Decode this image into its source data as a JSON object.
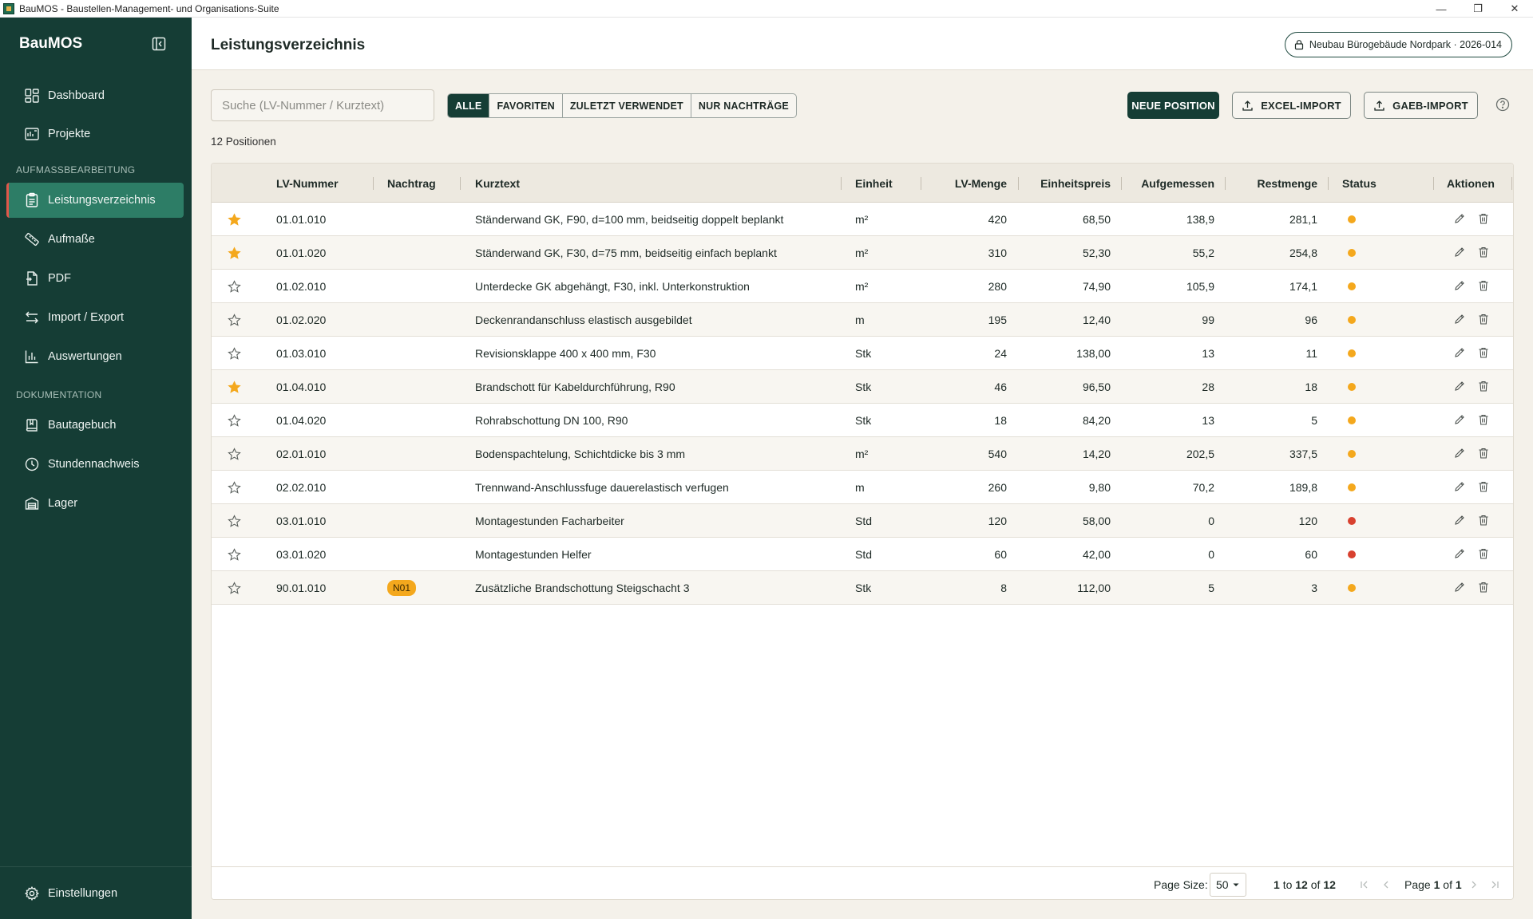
{
  "window": {
    "title": "BauMOS - Baustellen-Management- und Organisations-Suite",
    "controls": [
      "—",
      "❐",
      "✕"
    ]
  },
  "sidebar": {
    "brand": "BauMOS",
    "items_top": [
      {
        "label": "Dashboard",
        "icon": "dashboard-icon"
      },
      {
        "label": "Projekte",
        "icon": "projects-icon"
      }
    ],
    "section1": "AUFMASSBEARBEITUNG",
    "items_mid": [
      {
        "label": "Leistungsverzeichnis",
        "icon": "clipboard-icon",
        "active": true
      },
      {
        "label": "Aufmaße",
        "icon": "ruler-icon"
      },
      {
        "label": "PDF",
        "icon": "file-icon"
      },
      {
        "label": "Import / Export",
        "icon": "arrows-icon"
      },
      {
        "label": "Auswertungen",
        "icon": "chart-icon"
      }
    ],
    "section2": "DOKUMENTATION",
    "items_doc": [
      {
        "label": "Bautagebuch",
        "icon": "book-icon"
      },
      {
        "label": "Stundennachweis",
        "icon": "clock-icon"
      },
      {
        "label": "Lager",
        "icon": "warehouse-icon"
      }
    ],
    "settings": "Einstellungen"
  },
  "header": {
    "title": "Leistungsverzeichnis",
    "project": "Neubau Bürogebäude Nordpark · 2026-014"
  },
  "toolbar": {
    "search_placeholder": "Suche (LV-Nummer / Kurztext)",
    "filters": [
      "ALLE",
      "FAVORITEN",
      "ZULETZT VERWENDET",
      "NUR NACHTRÄGE"
    ],
    "active_filter": "ALLE",
    "new_button": "NEUE POSITION",
    "excel_button": "EXCEL-IMPORT",
    "gaeb_button": "GAEB-IMPORT"
  },
  "count_label": "12 Positionen",
  "table": {
    "headers": {
      "lv": "LV-Nummer",
      "nachtrag": "Nachtrag",
      "kurztext": "Kurztext",
      "einheit": "Einheit",
      "menge": "LV-Menge",
      "preis": "Einheitspreis",
      "aufgemessen": "Aufgemessen",
      "rest": "Restmenge",
      "status": "Status",
      "aktionen": "Aktionen"
    },
    "rows": [
      {
        "fav": true,
        "lv": "01.01.010",
        "nachtrag": "",
        "kurztext": "Ständerwand GK, F90, d=100 mm, beidseitig doppelt beplankt",
        "einheit": "m²",
        "menge": "420",
        "preis": "68,50",
        "aufgemessen": "138,9",
        "rest": "281,1",
        "status": "orange"
      },
      {
        "fav": true,
        "lv": "01.01.020",
        "nachtrag": "",
        "kurztext": "Ständerwand GK, F30, d=75 mm, beidseitig einfach beplankt",
        "einheit": "m²",
        "menge": "310",
        "preis": "52,30",
        "aufgemessen": "55,2",
        "rest": "254,8",
        "status": "orange"
      },
      {
        "fav": false,
        "lv": "01.02.010",
        "nachtrag": "",
        "kurztext": "Unterdecke GK abgehängt, F30, inkl. Unterkonstruktion",
        "einheit": "m²",
        "menge": "280",
        "preis": "74,90",
        "aufgemessen": "105,9",
        "rest": "174,1",
        "status": "orange"
      },
      {
        "fav": false,
        "lv": "01.02.020",
        "nachtrag": "",
        "kurztext": "Deckenrandanschluss elastisch ausgebildet",
        "einheit": "m",
        "menge": "195",
        "preis": "12,40",
        "aufgemessen": "99",
        "rest": "96",
        "status": "orange"
      },
      {
        "fav": false,
        "lv": "01.03.010",
        "nachtrag": "",
        "kurztext": "Revisionsklappe 400 x 400 mm, F30",
        "einheit": "Stk",
        "menge": "24",
        "preis": "138,00",
        "aufgemessen": "13",
        "rest": "11",
        "status": "orange"
      },
      {
        "fav": true,
        "lv": "01.04.010",
        "nachtrag": "",
        "kurztext": "Brandschott für Kabeldurchführung, R90",
        "einheit": "Stk",
        "menge": "46",
        "preis": "96,50",
        "aufgemessen": "28",
        "rest": "18",
        "status": "orange"
      },
      {
        "fav": false,
        "lv": "01.04.020",
        "nachtrag": "",
        "kurztext": "Rohrabschottung DN 100, R90",
        "einheit": "Stk",
        "menge": "18",
        "preis": "84,20",
        "aufgemessen": "13",
        "rest": "5",
        "status": "orange"
      },
      {
        "fav": false,
        "lv": "02.01.010",
        "nachtrag": "",
        "kurztext": "Bodenspachtelung, Schichtdicke bis 3 mm",
        "einheit": "m²",
        "menge": "540",
        "preis": "14,20",
        "aufgemessen": "202,5",
        "rest": "337,5",
        "status": "orange"
      },
      {
        "fav": false,
        "lv": "02.02.010",
        "nachtrag": "",
        "kurztext": "Trennwand-Anschlussfuge dauerelastisch verfugen",
        "einheit": "m",
        "menge": "260",
        "preis": "9,80",
        "aufgemessen": "70,2",
        "rest": "189,8",
        "status": "orange"
      },
      {
        "fav": false,
        "lv": "03.01.010",
        "nachtrag": "",
        "kurztext": "Montagestunden Facharbeiter",
        "einheit": "Std",
        "menge": "120",
        "preis": "58,00",
        "aufgemessen": "0",
        "rest": "120",
        "status": "red"
      },
      {
        "fav": false,
        "lv": "03.01.020",
        "nachtrag": "",
        "kurztext": "Montagestunden Helfer",
        "einheit": "Std",
        "menge": "60",
        "preis": "42,00",
        "aufgemessen": "0",
        "rest": "60",
        "status": "red"
      },
      {
        "fav": false,
        "lv": "90.01.010",
        "nachtrag": "N01",
        "kurztext": "Zusätzliche Brandschottung Steigschacht 3",
        "einheit": "Stk",
        "menge": "8",
        "preis": "112,00",
        "aufgemessen": "5",
        "rest": "3",
        "status": "orange"
      }
    ]
  },
  "footer": {
    "page_size_label": "Page Size:",
    "page_size": "50",
    "range_from": "1",
    "range_to": "12",
    "range_total": "12",
    "to_word": "to",
    "of_word": "of",
    "page_word": "Page",
    "page_current": "1",
    "page_total": "1"
  },
  "colors": {
    "sidebar": "#153d35",
    "active": "#2d7d66",
    "accent_star": "#f4a81d",
    "status_orange": "#f4a81d",
    "status_red": "#d8412f"
  }
}
